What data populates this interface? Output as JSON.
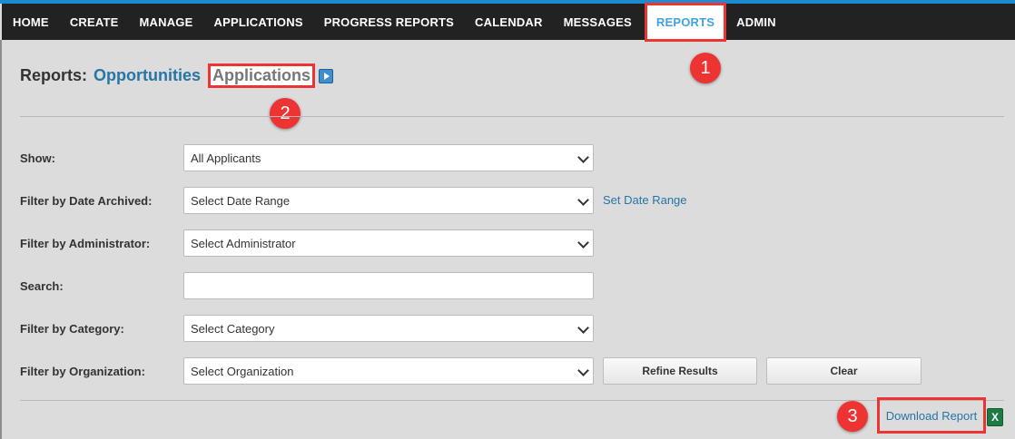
{
  "nav": {
    "items": [
      {
        "label": "HOME"
      },
      {
        "label": "CREATE"
      },
      {
        "label": "MANAGE"
      },
      {
        "label": "APPLICATIONS"
      },
      {
        "label": "PROGRESS REPORTS"
      },
      {
        "label": "CALENDAR"
      },
      {
        "label": "MESSAGES"
      },
      {
        "label": "REPORTS",
        "active": true
      },
      {
        "label": "ADMIN"
      }
    ]
  },
  "page": {
    "title_prefix": "Reports:",
    "tab_opportunities": "Opportunities",
    "tab_applications": "Applications"
  },
  "callouts": [
    "1",
    "2",
    "3"
  ],
  "filters": {
    "show": {
      "label": "Show:",
      "value": "All Applicants"
    },
    "date_archived": {
      "label": "Filter by Date Archived:",
      "value": "Select Date Range",
      "link": "Set Date Range"
    },
    "administrator": {
      "label": "Filter by Administrator:",
      "value": "Select Administrator"
    },
    "search": {
      "label": "Search:",
      "value": ""
    },
    "category": {
      "label": "Filter by Category:",
      "value": "Select Category"
    },
    "organization": {
      "label": "Filter by Organization:",
      "value": "Select Organization"
    }
  },
  "buttons": {
    "refine": "Refine Results",
    "clear": "Clear"
  },
  "download": {
    "label": "Download Report",
    "icon_letter": "X"
  },
  "colors": {
    "nav_bg": "#222222",
    "accent": "#2675a6",
    "highlight": "#ee3333"
  }
}
